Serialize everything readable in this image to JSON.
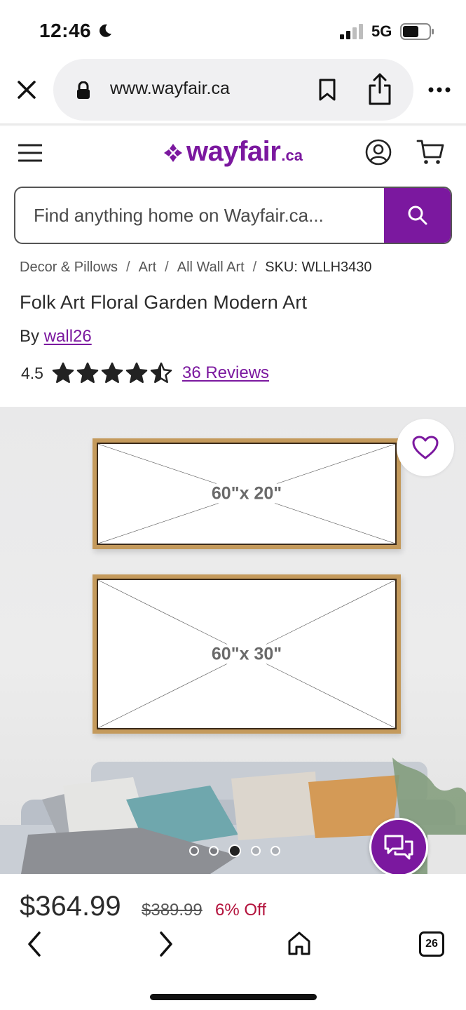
{
  "status_bar": {
    "time": "12:46",
    "network": "5G",
    "icons": [
      "moon-icon",
      "signal-icon",
      "battery-icon"
    ]
  },
  "browser": {
    "url": "www.wayfair.ca",
    "icons": [
      "close-icon",
      "lock-icon",
      "bookmark-icon",
      "share-icon",
      "more-icon"
    ]
  },
  "site_header": {
    "logo_word": "wayfair",
    "logo_tld": ".ca",
    "icons": [
      "menu-icon",
      "account-icon",
      "cart-icon"
    ],
    "brand_color": "#7b189f"
  },
  "search": {
    "placeholder": "Find anything home on Wayfair.ca..."
  },
  "breadcrumb": {
    "items": [
      "Decor & Pillows",
      "Art",
      "All Wall Art"
    ],
    "separator": "/",
    "sku": "SKU: WLLH3430"
  },
  "product": {
    "title": "Folk Art Floral Garden Modern Art",
    "by_label": "By",
    "brand": "wall26",
    "rating": "4.5",
    "rating_value": 4.5,
    "rating_max": 5,
    "reviews_label": "36 Reviews"
  },
  "gallery": {
    "frames": [
      {
        "label": "60\"x 20\""
      },
      {
        "label": "60\"x 30\""
      }
    ],
    "dot_count": 5,
    "active_dot": 2
  },
  "pricing": {
    "current": "$364.99",
    "original": "$389.99",
    "discount": "6% Off",
    "discount_color": "#b3123c"
  },
  "bottom_toolbar": {
    "tab_count": "26",
    "icons": [
      "back-icon",
      "forward-icon",
      "home-icon",
      "tabs-icon"
    ]
  }
}
